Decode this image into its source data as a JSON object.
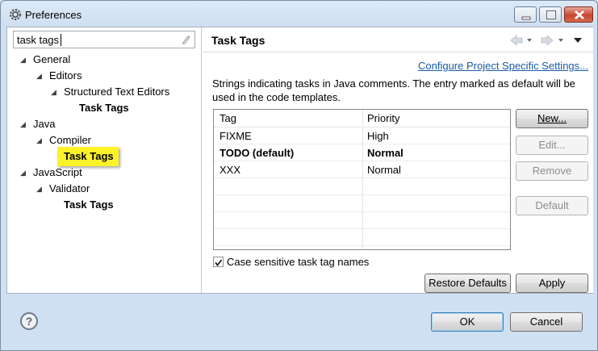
{
  "window": {
    "title": "Preferences"
  },
  "filter": {
    "value": "task tags"
  },
  "tree": {
    "items": [
      {
        "label": "General",
        "arrow": "◢"
      },
      {
        "label": "Editors",
        "arrow": "◢"
      },
      {
        "label": "Structured Text Editors",
        "arrow": "◢"
      },
      {
        "label": "Task Tags"
      },
      {
        "label": "Java",
        "arrow": "◢"
      },
      {
        "label": "Compiler",
        "arrow": "◢"
      },
      {
        "label": "Task Tags"
      },
      {
        "label": "JavaScript",
        "arrow": "◢"
      },
      {
        "label": "Validator",
        "arrow": "◢"
      },
      {
        "label": "Task Tags"
      }
    ]
  },
  "page": {
    "title": "Task Tags",
    "configure_link": "Configure Project Specific Settings...",
    "description": "Strings indicating tasks in Java comments. The entry marked as default will be used in the code templates."
  },
  "table": {
    "headers": [
      "Tag",
      "Priority"
    ],
    "rows": [
      {
        "tag": "FIXME",
        "priority": "High"
      },
      {
        "tag": "TODO (default)",
        "priority": "Normal"
      },
      {
        "tag": "XXX",
        "priority": "Normal"
      }
    ]
  },
  "buttons": {
    "new": "New...",
    "edit": "Edit...",
    "remove": "Remove",
    "default": "Default",
    "restore_defaults": "Restore Defaults",
    "apply": "Apply",
    "ok": "OK",
    "cancel": "Cancel"
  },
  "checkbox": {
    "label": "Case sensitive task tag names",
    "checked": true
  },
  "help": {
    "glyph": "?"
  }
}
